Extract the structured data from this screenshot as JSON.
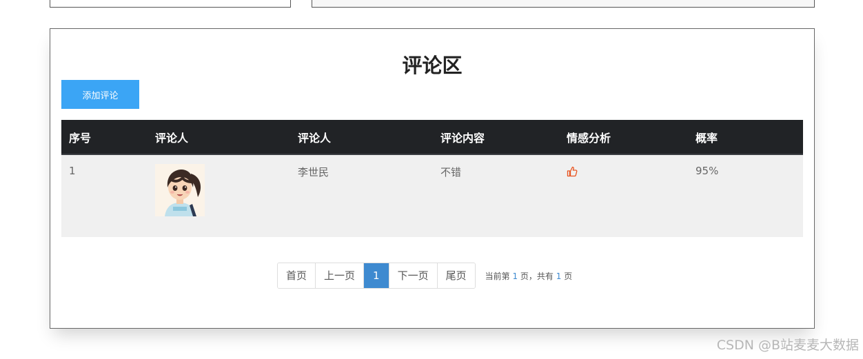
{
  "panel": {
    "title": "评论区",
    "add_button_label": "添加评论"
  },
  "table": {
    "headers": [
      "序号",
      "评论人",
      "评论人",
      "评论内容",
      "情感分析",
      "概率"
    ],
    "rows": [
      {
        "index": "1",
        "avatar_icon": "avatar-cartoon-girl-icon",
        "commenter": "李世民",
        "content": "不错",
        "sentiment_icon": "thumbs-up-icon",
        "probability": "95%"
      }
    ]
  },
  "pagination": {
    "first": "首页",
    "prev": "上一页",
    "current": "1",
    "next": "下一页",
    "last": "尾页",
    "info_prefix": "当前第",
    "info_current": "1",
    "info_middle": "页，共有",
    "info_total": "1",
    "info_suffix": "页"
  },
  "watermark": "CSDN @B站麦麦大数据",
  "colors": {
    "accent_button": "#3ba5f5",
    "table_header_bg": "#212326",
    "row_bg": "#f0f0f0",
    "active_page": "#3e8ad0",
    "thumb_icon": "#e8531f"
  }
}
